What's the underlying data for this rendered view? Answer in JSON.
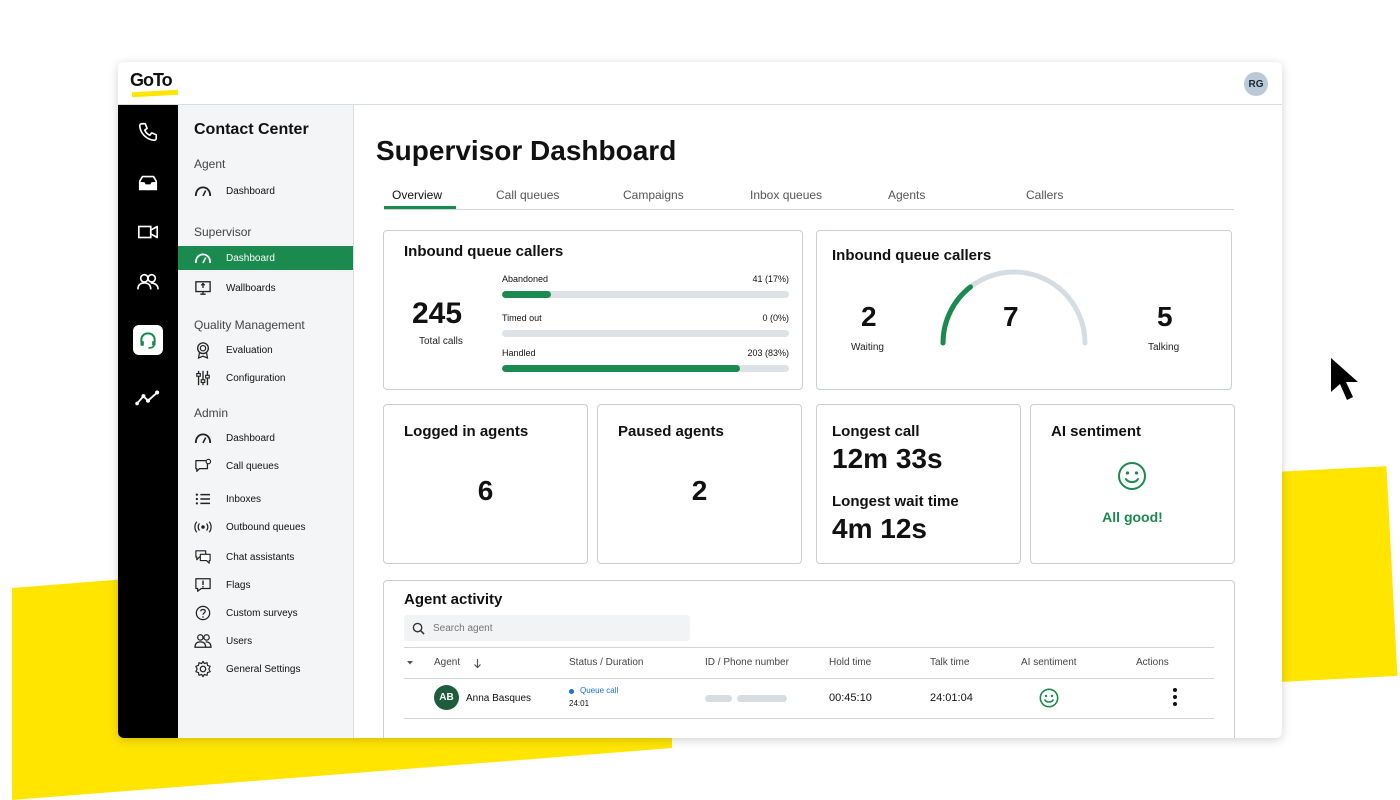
{
  "app": {
    "logo_text": "GoTo",
    "user_initials": "RG"
  },
  "sidebar": {
    "title": "Contact Center",
    "groups": [
      "Agent",
      "Supervisor",
      "Quality Management",
      "Admin"
    ],
    "items": [
      {
        "label": "Dashboard",
        "icon": "gauge-icon"
      },
      {
        "label": "Dashboard",
        "icon": "gauge-icon"
      },
      {
        "label": "Wallboards",
        "icon": "monitor-icon"
      },
      {
        "label": "Evaluation",
        "icon": "ribbon-icon"
      },
      {
        "label": "Configuration",
        "icon": "sliders-icon"
      },
      {
        "label": "Dashboard",
        "icon": "gauge-icon"
      },
      {
        "label": "Call queues",
        "icon": "chat-phone-icon"
      },
      {
        "label": "Inboxes",
        "icon": "list-icon"
      },
      {
        "label": "Outbound queues",
        "icon": "broadcast-icon"
      },
      {
        "label": "Chat assistants",
        "icon": "chat-bubbles-icon"
      },
      {
        "label": "Flags",
        "icon": "flag-message-icon"
      },
      {
        "label": "Custom surveys",
        "icon": "question-icon"
      },
      {
        "label": "Users",
        "icon": "users-icon"
      },
      {
        "label": "General Settings",
        "icon": "gear-icon"
      }
    ]
  },
  "rail": [
    "phone-icon",
    "inbox-icon",
    "video-icon",
    "people-icon",
    "headset-icon",
    "analytics-icon"
  ],
  "main": {
    "title": "Supervisor Dashboard",
    "tabs": [
      "Overview",
      "Call queues",
      "Campaigns",
      "Inbox queues",
      "Agents",
      "Callers"
    ],
    "active_tab": "Overview"
  },
  "inbound_calls": {
    "title": "Inbound queue callers",
    "total": "245",
    "total_label": "Total calls",
    "bars": [
      {
        "label": "Abandoned",
        "value": "41 (17%)",
        "percent": 17
      },
      {
        "label": "Timed out",
        "value": "0 (0%)",
        "percent": 0
      },
      {
        "label": "Handled",
        "value": "203 (83%)",
        "percent": 83
      }
    ]
  },
  "inbound_gauge": {
    "title": "Inbound queue callers",
    "waiting": "2",
    "waiting_label": "Waiting",
    "center": "7",
    "talking": "5",
    "talking_label": "Talking",
    "fraction": 0.29,
    "color": "#1b8a4e"
  },
  "logged_in": {
    "title": "Logged in agents",
    "value": "6"
  },
  "paused": {
    "title": "Paused agents",
    "value": "2"
  },
  "longest": {
    "call_title": "Longest call",
    "call_value": "12m 33s",
    "wait_title": "Longest wait time",
    "wait_value": "4m 12s"
  },
  "sentiment": {
    "title": "AI sentiment",
    "status": "All good!",
    "color": "#1b8a4e"
  },
  "agent_activity": {
    "title": "Agent activity",
    "search_placeholder": "Search agent",
    "columns": [
      "Agent",
      "Status / Duration",
      "ID / Phone number",
      "Hold time",
      "Talk time",
      "AI sentiment",
      "Actions"
    ],
    "rows": [
      {
        "initials": "AB",
        "name": "Anna Basques",
        "status": "Queue call",
        "duration": "24:01",
        "hold": "00:45:10",
        "talk": "24:01:04"
      }
    ]
  }
}
